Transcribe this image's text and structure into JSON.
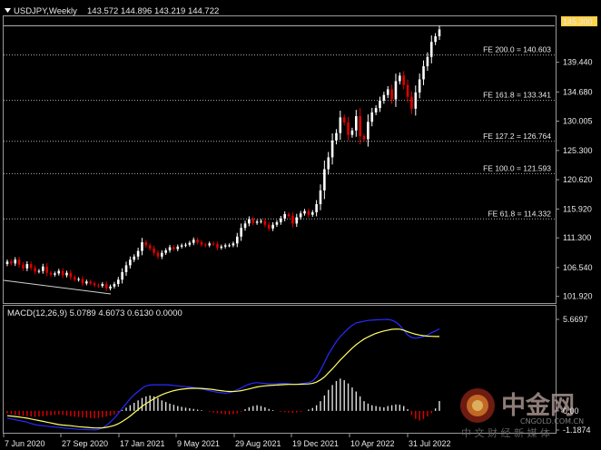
{
  "symbol_title": "USDJPY,Weekly",
  "ohlc_readout": "143.572 144.896 143.219 144.722",
  "macd_label": "MACD(12,26,9) 5.0789 4.6073 0.6130 0.0000",
  "price_badge": "145.300",
  "colors": {
    "background": "#000000",
    "bull": "#ffffff",
    "bear": "#e00000",
    "fe_line": "#b0b0b0",
    "macd_main": "#1a1aff",
    "macd_signal": "#ffff66",
    "histogram": "#e0e0e0",
    "badge": "#ffd24d"
  },
  "watermark": {
    "brand": "中金网",
    "domain": "CNGOLD.COM.CN",
    "slogan": "中 文 财 经 新 媒 体"
  },
  "chart_data": {
    "type": "candlestick",
    "price_axis": {
      "ticks": [
        145.3,
        139.44,
        134.68,
        130.005,
        125.3,
        120.62,
        115.92,
        111.3,
        106.54,
        101.92
      ],
      "ylim": [
        101.0,
        146.8
      ]
    },
    "fib_levels": [
      {
        "label": "FE 200.0 = 140.603",
        "value": 140.603
      },
      {
        "label": "FE 161.8 = 133.341",
        "value": 133.341
      },
      {
        "label": "FE 127.2 = 126.764",
        "value": 126.764
      },
      {
        "label": "FE 100.0 = 121.593",
        "value": 121.593
      },
      {
        "label": "FE 61.8 = 114.332",
        "value": 114.332
      }
    ],
    "x_axis_labels": [
      "7 Jun 2020",
      "27 Sep 2020",
      "17 Jan 2021",
      "9 May 2021",
      "29 Aug 2021",
      "19 Dec 2021",
      "10 Apr 2022",
      "31 Jul 2022"
    ],
    "closes": [
      107.5,
      107.2,
      107.8,
      107.0,
      106.4,
      107.1,
      106.5,
      105.9,
      106.0,
      106.7,
      105.7,
      105.4,
      105.6,
      106.0,
      105.3,
      105.7,
      105.0,
      104.6,
      104.7,
      104.0,
      104.3,
      104.0,
      103.7,
      103.6,
      103.9,
      103.2,
      103.5,
      103.9,
      104.6,
      105.8,
      106.9,
      107.8,
      108.3,
      109.2,
      110.6,
      110.1,
      109.6,
      108.9,
      108.3,
      108.9,
      109.3,
      109.8,
      109.5,
      109.9,
      110.1,
      110.2,
      110.5,
      111.0,
      110.6,
      110.2,
      110.1,
      110.4,
      110.3,
      109.7,
      109.9,
      110.1,
      110.1,
      110.4,
      111.5,
      112.9,
      113.6,
      114.3,
      113.7,
      113.9,
      114.0,
      113.4,
      112.8,
      113.4,
      113.8,
      114.4,
      115.1,
      114.8,
      113.6,
      114.6,
      115.2,
      115.6,
      115.0,
      115.4,
      116.7,
      118.9,
      122.3,
      124.2,
      126.9,
      128.1,
      130.6,
      129.8,
      127.8,
      128.5,
      130.8,
      127.6,
      127.1,
      129.9,
      131.4,
      132.1,
      133.3,
      134.2,
      135.1,
      133.5,
      136.4,
      137.3,
      135.8,
      133.9,
      132.0,
      134.6,
      136.7,
      138.8,
      140.3,
      142.7,
      143.6,
      144.7
    ],
    "macd": {
      "label": "MACD(12,26,9)",
      "main_value": 5.0789,
      "signal_value": 4.6073,
      "axis_labels": [
        "5.6697",
        "0.00",
        "-1.1874"
      ],
      "histogram": [
        -0.15,
        -0.2,
        -0.25,
        -0.28,
        -0.3,
        -0.32,
        -0.35,
        -0.37,
        -0.35,
        -0.33,
        -0.3,
        -0.28,
        -0.25,
        -0.22,
        -0.25,
        -0.3,
        -0.34,
        -0.36,
        -0.38,
        -0.4,
        -0.42,
        -0.44,
        -0.46,
        -0.44,
        -0.4,
        -0.35,
        -0.3,
        -0.22,
        -0.1,
        0.05,
        0.2,
        0.35,
        0.5,
        0.65,
        0.8,
        0.9,
        0.95,
        0.9,
        0.8,
        0.65,
        0.55,
        0.45,
        0.38,
        0.3,
        0.25,
        0.2,
        0.16,
        0.12,
        0.08,
        0.04,
        0.0,
        -0.05,
        -0.1,
        -0.14,
        -0.18,
        -0.2,
        -0.22,
        -0.2,
        -0.15,
        -0.05,
        0.1,
        0.22,
        0.3,
        0.35,
        0.3,
        0.22,
        0.12,
        0.05,
        0.0,
        -0.05,
        -0.08,
        -0.1,
        -0.12,
        -0.1,
        -0.06,
        0.0,
        0.08,
        0.18,
        0.35,
        0.6,
        0.95,
        1.3,
        1.6,
        1.85,
        2.0,
        1.9,
        1.7,
        1.45,
        1.2,
        0.9,
        0.6,
        0.45,
        0.35,
        0.3,
        0.25,
        0.22,
        0.3,
        0.35,
        0.4,
        0.38,
        0.3,
        0.1,
        -0.25,
        -0.5,
        -0.6,
        -0.5,
        -0.35,
        -0.15,
        0.15,
        0.61
      ],
      "main": [
        -0.45,
        -0.5,
        -0.55,
        -0.6,
        -0.65,
        -0.7,
        -0.78,
        -0.85,
        -0.9,
        -0.92,
        -0.95,
        -0.98,
        -1.0,
        -1.02,
        -1.05,
        -1.08,
        -1.1,
        -1.12,
        -1.14,
        -1.15,
        -1.16,
        -1.17,
        -1.18,
        -1.15,
        -1.05,
        -0.9,
        -0.7,
        -0.45,
        -0.15,
        0.15,
        0.45,
        0.75,
        1.0,
        1.2,
        1.4,
        1.55,
        1.6,
        1.62,
        1.62,
        1.62,
        1.62,
        1.6,
        1.58,
        1.55,
        1.52,
        1.5,
        1.48,
        1.45,
        1.4,
        1.35,
        1.3,
        1.25,
        1.2,
        1.15,
        1.12,
        1.1,
        1.12,
        1.2,
        1.3,
        1.42,
        1.55,
        1.65,
        1.72,
        1.75,
        1.72,
        1.7,
        1.68,
        1.68,
        1.68,
        1.7,
        1.7,
        1.68,
        1.65,
        1.65,
        1.68,
        1.72,
        1.75,
        1.85,
        2.1,
        2.5,
        3.0,
        3.5,
        3.9,
        4.3,
        4.6,
        4.85,
        5.1,
        5.3,
        5.45,
        5.5,
        5.55,
        5.6,
        5.62,
        5.64,
        5.65,
        5.66,
        5.67,
        5.62,
        5.5,
        5.3,
        5.0,
        4.7,
        4.55,
        4.5,
        4.55,
        4.6,
        4.7,
        4.85,
        4.95,
        5.0789
      ],
      "signal": [
        -0.3,
        -0.32,
        -0.35,
        -0.38,
        -0.42,
        -0.45,
        -0.5,
        -0.55,
        -0.6,
        -0.65,
        -0.7,
        -0.75,
        -0.8,
        -0.85,
        -0.88,
        -0.9,
        -0.92,
        -0.95,
        -0.98,
        -1.0,
        -1.02,
        -1.04,
        -1.06,
        -1.06,
        -1.05,
        -1.02,
        -0.97,
        -0.9,
        -0.8,
        -0.66,
        -0.5,
        -0.32,
        -0.12,
        0.08,
        0.28,
        0.45,
        0.6,
        0.75,
        0.88,
        1.0,
        1.1,
        1.18,
        1.25,
        1.3,
        1.34,
        1.37,
        1.39,
        1.4,
        1.4,
        1.39,
        1.37,
        1.35,
        1.32,
        1.28,
        1.25,
        1.22,
        1.2,
        1.2,
        1.22,
        1.25,
        1.3,
        1.36,
        1.42,
        1.48,
        1.52,
        1.55,
        1.57,
        1.59,
        1.6,
        1.62,
        1.63,
        1.64,
        1.64,
        1.64,
        1.65,
        1.66,
        1.67,
        1.7,
        1.78,
        1.92,
        2.1,
        2.35,
        2.6,
        2.88,
        3.15,
        3.4,
        3.65,
        3.88,
        4.1,
        4.28,
        4.45,
        4.58,
        4.7,
        4.8,
        4.88,
        4.95,
        5.0,
        5.05,
        5.07,
        5.06,
        5.0,
        4.9,
        4.82,
        4.75,
        4.7,
        4.66,
        4.63,
        4.62,
        4.61,
        4.6073
      ]
    }
  }
}
